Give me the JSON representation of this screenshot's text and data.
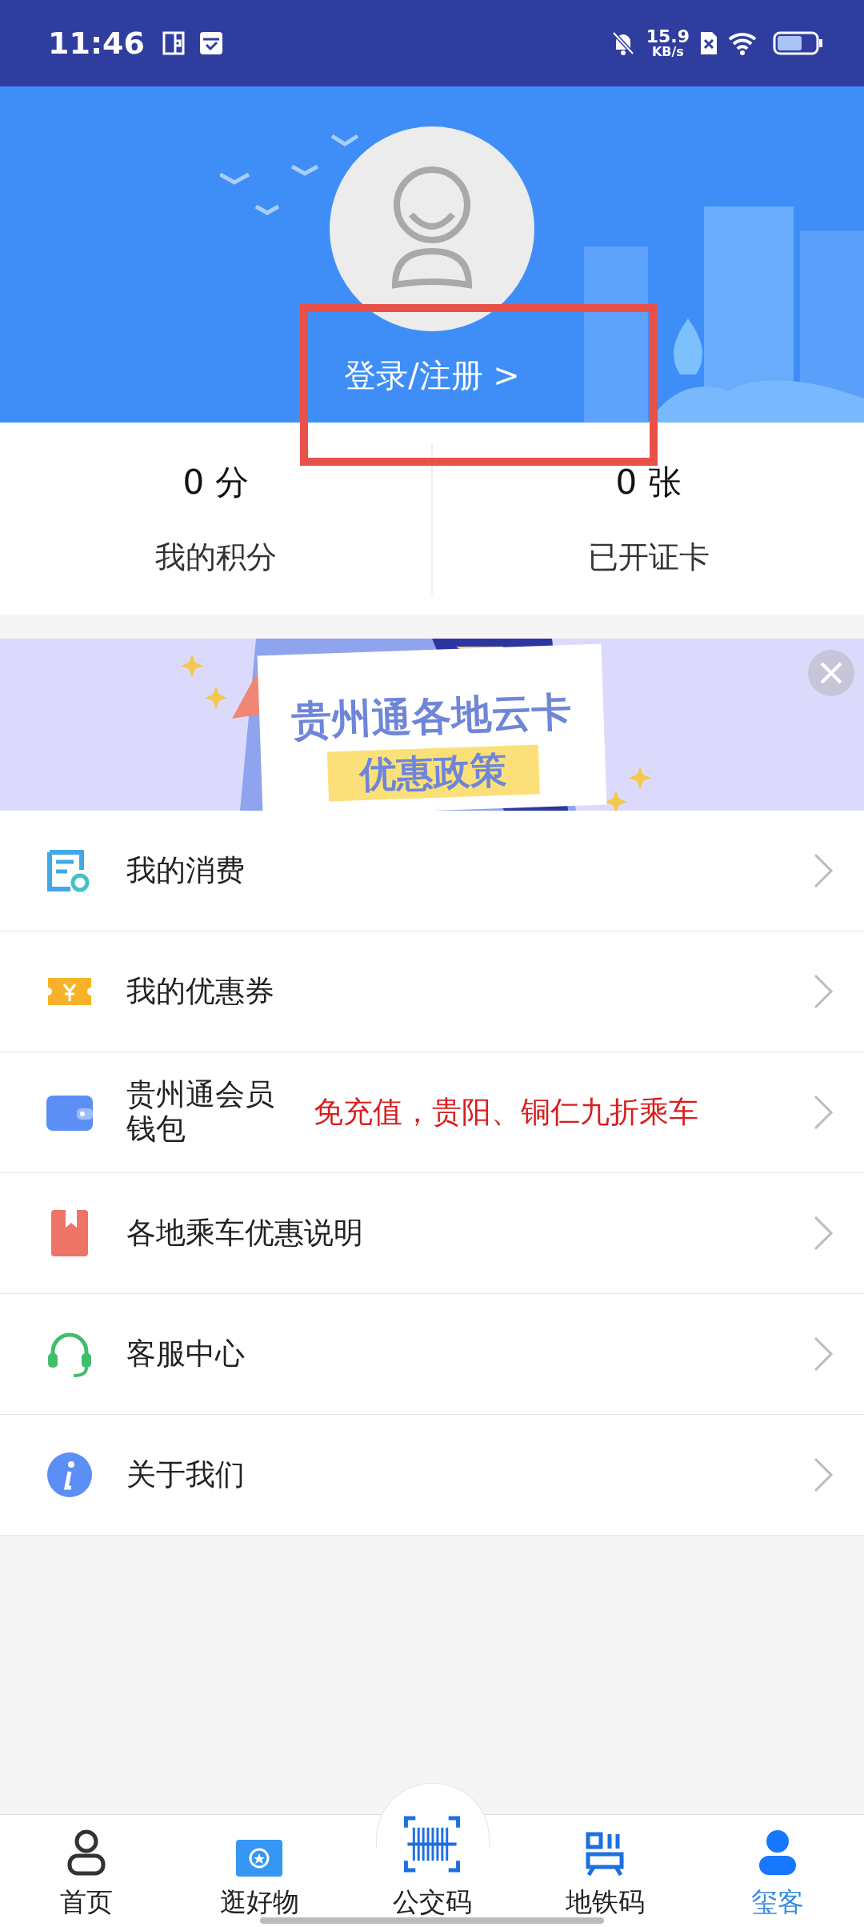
{
  "status_bar": {
    "time": "11:46",
    "speed_value": "15.9",
    "speed_unit": "KB/s"
  },
  "profile": {
    "login_link": "登录/注册 >",
    "highlighted": true
  },
  "stats": [
    {
      "value": "0 分",
      "label": "我的积分"
    },
    {
      "value": "0 张",
      "label": "已开证卡"
    }
  ],
  "banner": {
    "title": "贵州通各地云卡",
    "subtitle": "优惠政策"
  },
  "menu": [
    {
      "kind": "receipt",
      "label": "我的消费"
    },
    {
      "kind": "coupon",
      "label": "我的优惠券"
    },
    {
      "kind": "wallet",
      "label": "贵州通会员钱包",
      "note": "免充值，贵阳、铜仁九折乘车"
    },
    {
      "kind": "bookmark",
      "label": "各地乘车优惠说明"
    },
    {
      "kind": "headset",
      "label": "客服中心"
    },
    {
      "kind": "info",
      "label": "关于我们"
    }
  ],
  "tab_bar": [
    {
      "kind": "home",
      "label": "首页",
      "selected": false
    },
    {
      "kind": "shop",
      "label": "逛好物",
      "selected": false
    },
    {
      "kind": "barcode",
      "label": "公交码",
      "selected": false
    },
    {
      "kind": "qr",
      "label": "地铁码",
      "selected": false
    },
    {
      "kind": "person",
      "label": "玺客",
      "selected": true
    }
  ]
}
